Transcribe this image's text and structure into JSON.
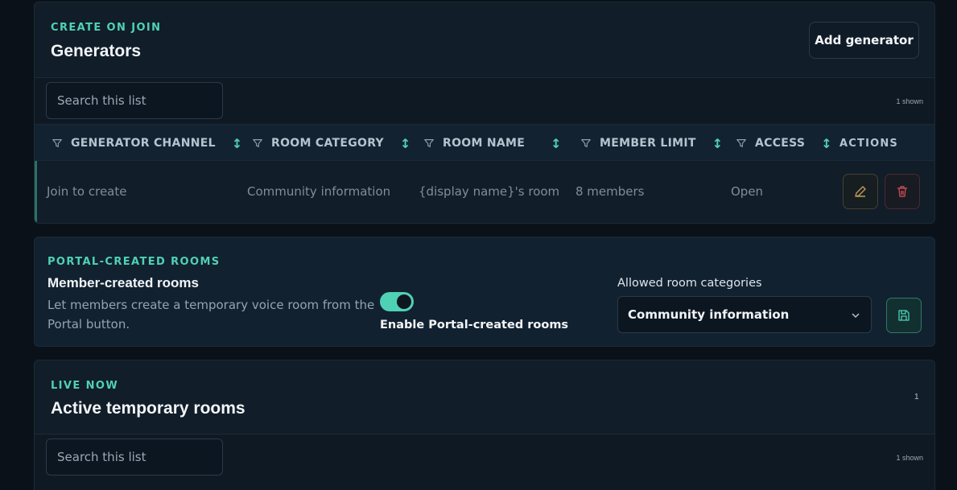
{
  "generators": {
    "eyebrow": "CREATE ON JOIN",
    "title": "Generators",
    "add_button": "Add generator",
    "search_placeholder": "Search this list",
    "shown": "1 shown",
    "columns": [
      "GENERATOR CHANNEL",
      "ROOM CATEGORY",
      "ROOM NAME",
      "MEMBER LIMIT",
      "ACCESS",
      "ACTIONS"
    ],
    "rows": [
      {
        "channel": "Join to create",
        "category": "Community information",
        "room_name": "{display name}'s room",
        "member_limit": "8 members",
        "access": "Open"
      }
    ]
  },
  "portal": {
    "eyebrow": "PORTAL-CREATED ROOMS",
    "title": "Member-created rooms",
    "description_line1": "Let members create a temporary voice room from the",
    "description_line2": "Portal button.",
    "toggle_label": "Enable Portal-created rooms",
    "toggle_on": true,
    "categories_label": "Allowed room categories",
    "categories_value": "Community information"
  },
  "live": {
    "eyebrow": "LIVE NOW",
    "title": "Active temporary rooms",
    "count": "1",
    "search_placeholder": "Search this list",
    "shown": "1 shown"
  },
  "colors": {
    "accent": "#4fd1b5",
    "background": "#0a1118",
    "card": "#111d28"
  },
  "icons": {
    "filter": "filter-icon",
    "sort": "sort-icon",
    "edit": "pencil-icon",
    "delete": "trash-icon",
    "save": "save-icon",
    "chevron": "chevron-down-icon"
  }
}
